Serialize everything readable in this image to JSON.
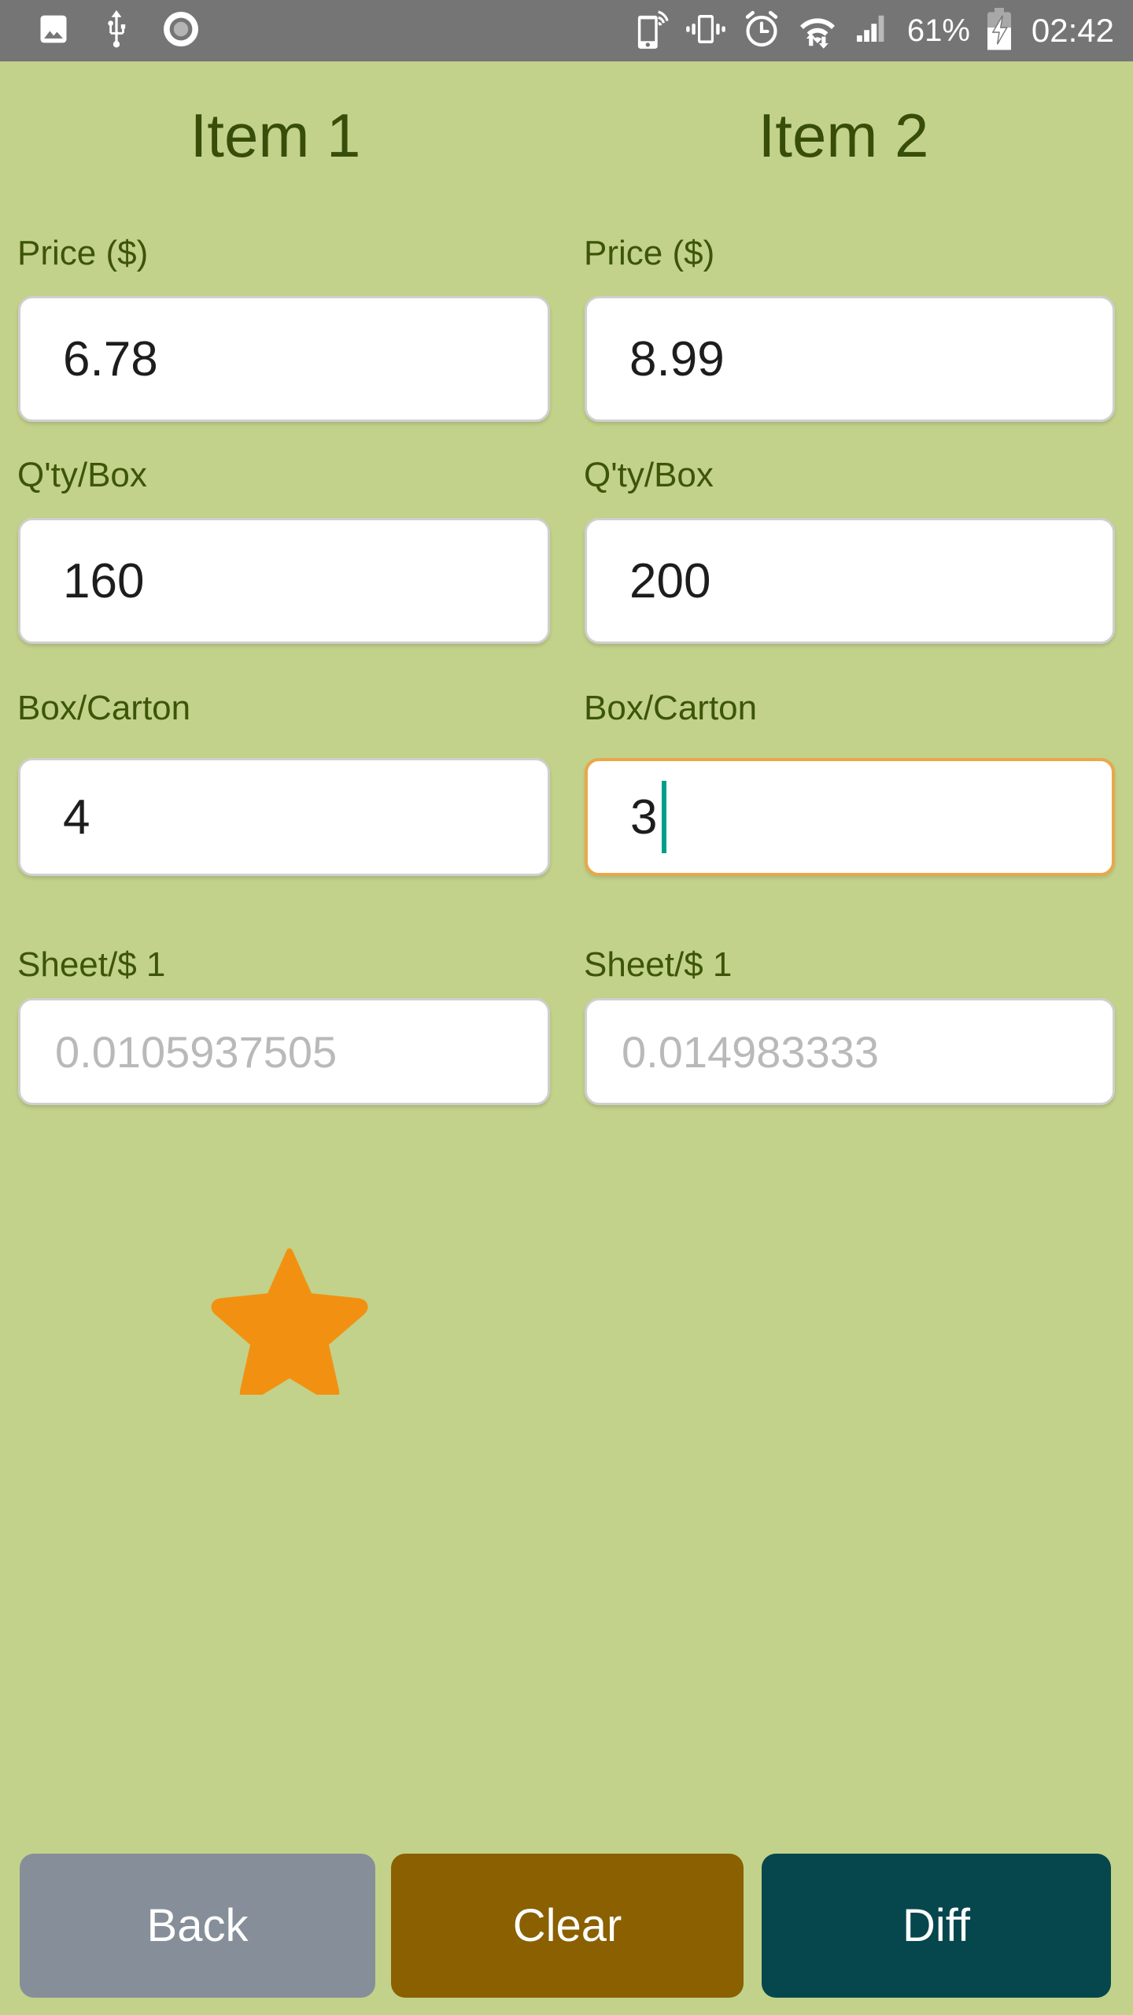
{
  "status_bar": {
    "left_icons": [
      "image-icon",
      "usb-icon",
      "record-circle-icon"
    ],
    "right_icons": [
      "hotspot-icon",
      "vibrate-icon",
      "alarm-icon",
      "wifi-data-icon",
      "signal-bars-icon",
      "battery-charging-icon"
    ],
    "battery_percent": "61%",
    "clock": "02:42",
    "background_color": "#757575"
  },
  "theme": {
    "background_color": "#c2d28a",
    "heading_color": "#374d09",
    "label_color": "#3d5509",
    "focus_border_color": "#e8a84a",
    "caret_color": "#009e87",
    "star_color": "#f29111"
  },
  "columns": [
    {
      "heading": "Item 1",
      "fields": {
        "price_label": "Price ($)",
        "price_value": "6.78",
        "qty_label": "Q'ty/Box",
        "qty_value": "160",
        "box_label": "Box/Carton",
        "box_value": "4",
        "sheet_label": "Sheet/$ 1",
        "sheet_value": "0.0105937505"
      }
    },
    {
      "heading": "Item 2",
      "fields": {
        "price_label": "Price ($)",
        "price_value": "8.99",
        "qty_label": "Q'ty/Box",
        "qty_value": "200",
        "box_label": "Box/Carton",
        "box_value": "3",
        "sheet_label": "Sheet/$ 1",
        "sheet_value": "0.014983333"
      }
    }
  ],
  "star": {
    "icon": "star-icon"
  },
  "buttons": {
    "back": "Back",
    "clear": "Clear",
    "diff": "Diff"
  }
}
